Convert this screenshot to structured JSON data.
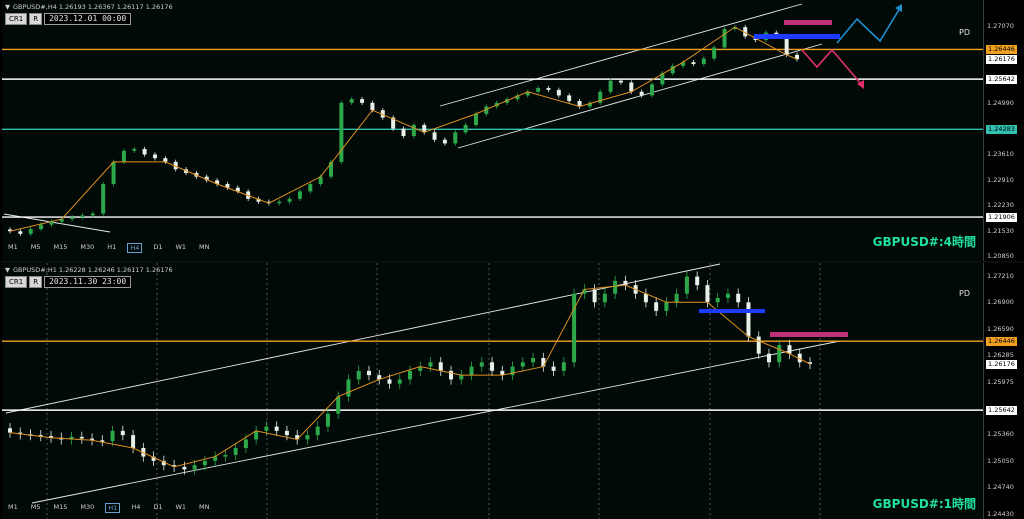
{
  "colors": {
    "bg": "#020a08",
    "candle": "#2ca84a",
    "candle_alt": "#e8f0e8",
    "level_orange": "#f0a020",
    "level_teal": "#30c0b0",
    "level_white": "#ffffff",
    "zigzag": "#e09020",
    "magenta": "#c0307a",
    "blue": "#1e3cff",
    "arrow_up": "#1e90d0",
    "arrow_down": "#e0306a"
  },
  "top": {
    "header": "GBPUSD#,H4  1.26193 1.26367 1.26117 1.26176",
    "btn_cr": "CR1",
    "btn_r": "R",
    "datetime": "2023.12.01 00:00",
    "timeframes": [
      "M1",
      "M5",
      "M15",
      "M30",
      "H1",
      "H4",
      "D1",
      "W1",
      "MN"
    ],
    "active_tf": "H4",
    "title": "GBPUSD#:4時間",
    "pd": "PD",
    "ticks": [
      "1.27070",
      "1.26446",
      "1.26176",
      "1.25642",
      "1.24990",
      "1.24283",
      "1.23610",
      "1.22910",
      "1.22230",
      "1.21906",
      "1.21530",
      "1.20850"
    ],
    "levels": [
      {
        "label": "1.26446",
        "value": 1.26446,
        "color": "#f0a020"
      },
      {
        "label": "1.25642",
        "value": 1.25642,
        "color": "#ffffff"
      },
      {
        "label": "1.24283",
        "value": 1.24283,
        "color": "#30c0b0"
      },
      {
        "label": "1.21906",
        "value": 1.21906,
        "color": "#ffffff"
      }
    ],
    "price_tag": "1.26176"
  },
  "bottom": {
    "header": "GBPUSD#,H1  1.26228 1.26246 1.26117 1.26176",
    "btn_cr": "CR1",
    "btn_r": "R",
    "datetime": "2023.11.30 23:00",
    "timeframes": [
      "M1",
      "M5",
      "M15",
      "M30",
      "H1",
      "H4",
      "D1",
      "W1",
      "MN"
    ],
    "active_tf": "H1",
    "title": "GBPUSD#:1時間",
    "pd": "PD",
    "ticks": [
      "1.27210",
      "1.26900",
      "1.26590",
      "1.26446",
      "1.26285",
      "1.26176",
      "1.25975",
      "1.25642",
      "1.25360",
      "1.25050",
      "1.24740",
      "1.24430"
    ],
    "levels": [
      {
        "label": "1.26446",
        "value": 1.26446,
        "color": "#f0a020"
      },
      {
        "label": "1.25642",
        "value": 1.25642,
        "color": "#ffffff"
      }
    ],
    "price_tag": "1.26176"
  },
  "chart_data": [
    {
      "type": "candlestick",
      "symbol": "GBPUSD#",
      "timeframe": "H4",
      "title": "GBPUSD#:4時間",
      "ylim": [
        1.2085,
        1.2765
      ],
      "close": [
        1.2152,
        1.2145,
        1.2158,
        1.217,
        1.2178,
        1.2185,
        1.219,
        1.2195,
        1.22,
        1.228,
        1.234,
        1.237,
        1.2375,
        1.236,
        1.235,
        1.234,
        1.232,
        1.231,
        1.23,
        1.229,
        1.228,
        1.227,
        1.226,
        1.224,
        1.2232,
        1.2228,
        1.2232,
        1.224,
        1.226,
        1.228,
        1.23,
        1.234,
        1.25,
        1.251,
        1.25,
        1.248,
        1.246,
        1.243,
        1.241,
        1.244,
        1.242,
        1.24,
        1.239,
        1.242,
        1.244,
        1.247,
        1.249,
        1.25,
        1.251,
        1.252,
        1.253,
        1.254,
        1.2535,
        1.252,
        1.2505,
        1.249,
        1.25,
        1.253,
        1.256,
        1.2555,
        1.253,
        1.252,
        1.255,
        1.258,
        1.26,
        1.261,
        1.2605,
        1.262,
        1.265,
        1.27,
        1.2705,
        1.268,
        1.267,
        1.269,
        1.268,
        1.263,
        1.2618
      ],
      "levels": [
        1.26446,
        1.25642,
        1.24283,
        1.21906
      ],
      "last_price": 1.26176
    },
    {
      "type": "candlestick",
      "symbol": "GBPUSD#",
      "timeframe": "H1",
      "title": "GBPUSD#:1時間",
      "ylim": [
        1.2443,
        1.273
      ],
      "close": [
        1.2538,
        1.2536,
        1.2535,
        1.2534,
        1.2532,
        1.253,
        1.2533,
        1.2531,
        1.2529,
        1.2528,
        1.254,
        1.2535,
        1.252,
        1.251,
        1.2505,
        1.25,
        1.2498,
        1.2495,
        1.25,
        1.2505,
        1.251,
        1.2512,
        1.252,
        1.253,
        1.254,
        1.2545,
        1.254,
        1.2535,
        1.253,
        1.2535,
        1.2545,
        1.256,
        1.258,
        1.26,
        1.261,
        1.2605,
        1.26,
        1.2595,
        1.26,
        1.261,
        1.2615,
        1.262,
        1.261,
        1.26,
        1.2605,
        1.2615,
        1.262,
        1.261,
        1.2605,
        1.2615,
        1.262,
        1.2625,
        1.2615,
        1.261,
        1.262,
        1.27,
        1.2705,
        1.269,
        1.27,
        1.2715,
        1.271,
        1.27,
        1.269,
        1.268,
        1.269,
        1.27,
        1.272,
        1.271,
        1.269,
        1.2695,
        1.27,
        1.269,
        1.265,
        1.263,
        1.262,
        1.264,
        1.263,
        1.262,
        1.2618
      ],
      "levels": [
        1.26446,
        1.25642
      ],
      "last_price": 1.26176
    }
  ]
}
